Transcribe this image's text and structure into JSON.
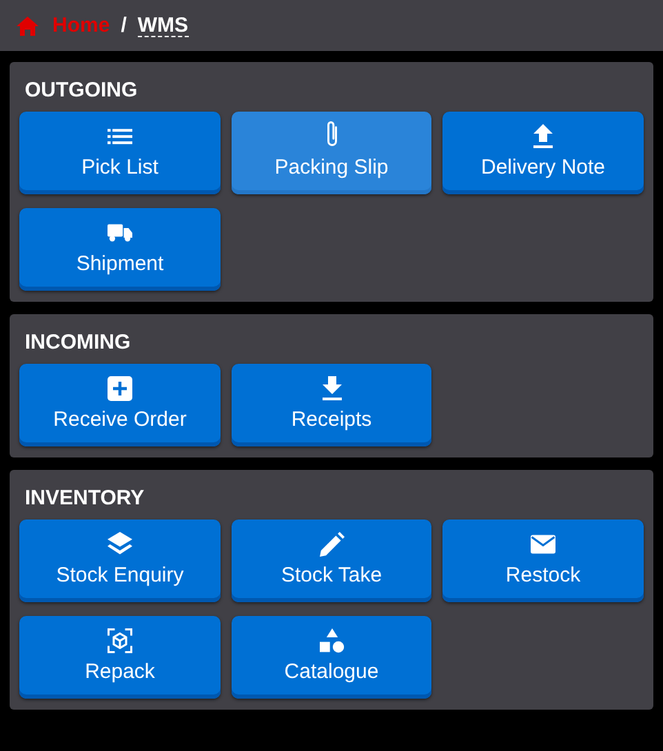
{
  "breadcrumb": {
    "home": "Home",
    "separator": "/",
    "current": "WMS"
  },
  "sections": [
    {
      "title": "OUTGOING",
      "buttons": [
        {
          "label": "Pick List",
          "kind": "list",
          "selected": false
        },
        {
          "label": "Packing Slip",
          "kind": "paperclip",
          "selected": true
        },
        {
          "label": "Delivery Note",
          "kind": "upload",
          "selected": false
        },
        {
          "label": "Shipment",
          "kind": "truck",
          "selected": false
        }
      ]
    },
    {
      "title": "INCOMING",
      "buttons": [
        {
          "label": "Receive Order",
          "kind": "plus",
          "selected": false
        },
        {
          "label": "Receipts",
          "kind": "download",
          "selected": false
        }
      ]
    },
    {
      "title": "INVENTORY",
      "buttons": [
        {
          "label": "Stock Enquiry",
          "kind": "layers",
          "selected": false
        },
        {
          "label": "Stock Take",
          "kind": "pencil",
          "selected": false
        },
        {
          "label": "Restock",
          "kind": "envelope",
          "selected": false
        },
        {
          "label": "Repack",
          "kind": "cube",
          "selected": false
        },
        {
          "label": "Catalogue",
          "kind": "shapes",
          "selected": false
        }
      ]
    }
  ]
}
